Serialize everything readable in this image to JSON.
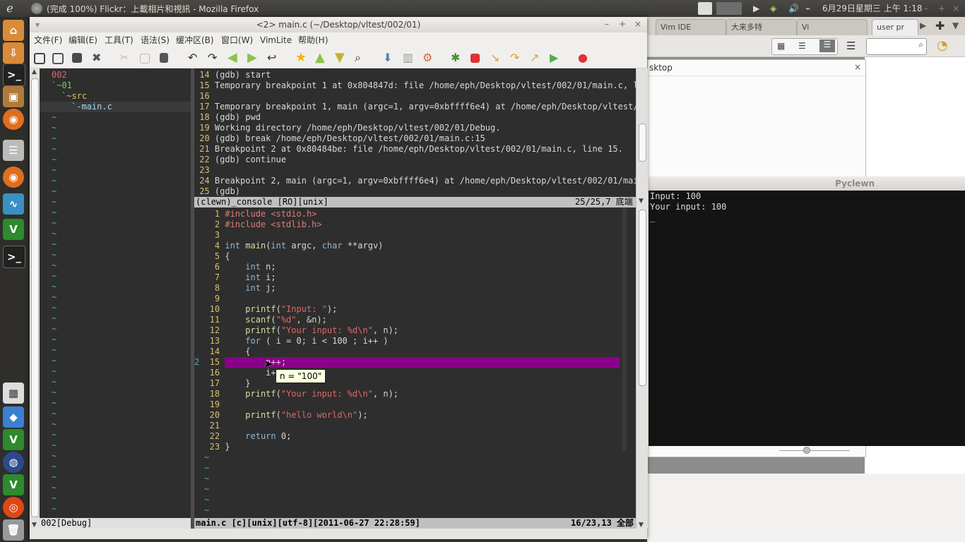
{
  "top_panel": {
    "window_title": "(完成 100%) Flickr：上載相片和視訊 - Mozilla Firefox",
    "datetime": "6月29日星期三 上午 1:18"
  },
  "firefox": {
    "tabs": [
      "Vim IDE",
      "大来多特",
      "Vi",
      "user pr"
    ],
    "dialog_title": "sktop"
  },
  "pyclewn": {
    "title": "Pyclewn",
    "lines": [
      "Input: 100",
      "Your input: 100",
      "_"
    ]
  },
  "gvim": {
    "title": "<2> main.c (~/Desktop/vltest/002/01)",
    "menu": [
      "文件(F)",
      "编辑(E)",
      "工具(T)",
      "语法(S)",
      "缓冲区(B)",
      "窗口(W)",
      "VimLite",
      "帮助(H)"
    ],
    "tree": [
      "002",
      "`~01",
      "`~src",
      "`-main.c"
    ],
    "tree_status": "002[Debug]",
    "console": {
      "lines": [
        {
          "n": "14",
          "t": "(gdb) start"
        },
        {
          "n": "15",
          "t": "Temporary breakpoint 1 at 0x804847d: file /home/eph/Desktop/vltest/002/01/main.c, l"
        },
        {
          "n": "16",
          "t": ""
        },
        {
          "n": "17",
          "t": "Temporary breakpoint 1, main (argc=1, argv=0xbffff6e4) at /home/eph/Desktop/vltest/"
        },
        {
          "n": "18",
          "t": "(gdb) pwd"
        },
        {
          "n": "19",
          "t": "Working directory /home/eph/Desktop/vltest/002/01/Debug."
        },
        {
          "n": "20",
          "t": "(gdb) break /home/eph/Desktop/vltest/002/01/main.c:15"
        },
        {
          "n": "21",
          "t": "Breakpoint 2 at 0x80484be: file /home/eph/Desktop/vltest/002/01/main.c, line 15."
        },
        {
          "n": "22",
          "t": "(gdb) continue"
        },
        {
          "n": "23",
          "t": ""
        },
        {
          "n": "24",
          "t": "Breakpoint 2, main (argc=1, argv=0xbffff6e4) at /home/eph/Desktop/vltest/002/01/mai"
        },
        {
          "n": "25",
          "t": "(gdb)"
        }
      ],
      "status_left": "(clewn)_console [RO][unix]",
      "status_right": "25/25,7 底端"
    },
    "code": [
      {
        "n": "1",
        "t": "#include <stdio.h>"
      },
      {
        "n": "2",
        "t": "#include <stdlib.h>"
      },
      {
        "n": "3",
        "t": ""
      },
      {
        "n": "4",
        "t": "int main(int argc, char **argv)"
      },
      {
        "n": "5",
        "t": "{"
      },
      {
        "n": "6",
        "t": "    int n;"
      },
      {
        "n": "7",
        "t": "    int i;"
      },
      {
        "n": "8",
        "t": "    int j;"
      },
      {
        "n": "9",
        "t": ""
      },
      {
        "n": "10",
        "t": "    printf(\"Input: \");"
      },
      {
        "n": "11",
        "t": "    scanf(\"%d\", &n);"
      },
      {
        "n": "12",
        "t": "    printf(\"Your input: %d\\n\", n);"
      },
      {
        "n": "13",
        "t": "    for ( i = 0; i < 100 ; i++ )"
      },
      {
        "n": "14",
        "t": "    {"
      },
      {
        "n": "15",
        "t": "        n++;"
      },
      {
        "n": "16",
        "t": "        i++;"
      },
      {
        "n": "17",
        "t": "    }"
      },
      {
        "n": "18",
        "t": "    printf(\"Your input: %d\\n\", n);"
      },
      {
        "n": "19",
        "t": ""
      },
      {
        "n": "20",
        "t": "    printf(\"hello world\\n\");"
      },
      {
        "n": "21",
        "t": ""
      },
      {
        "n": "22",
        "t": "    return 0;"
      },
      {
        "n": "23",
        "t": "}"
      }
    ],
    "breakpoint_sign": "2",
    "tooltip": "n = \"100\"",
    "status_left": "main.c [c][unix][utf-8][2011-06-27 22:28:59]",
    "status_right": "16/23,13 全部"
  },
  "colors": {
    "editor_bg": "#2e2e2e",
    "highlight": "#8b008b",
    "status_bg": "#c0c0c0"
  }
}
